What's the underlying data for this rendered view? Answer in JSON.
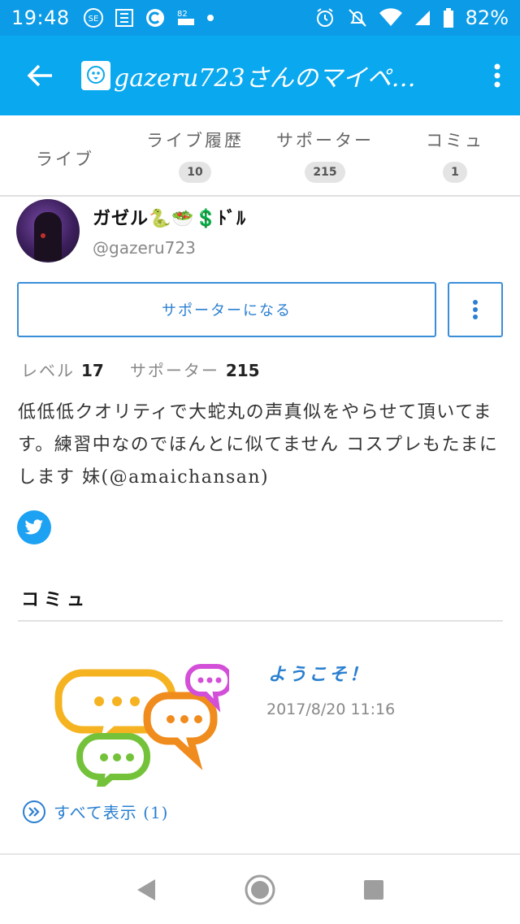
{
  "status_bar": {
    "time": "19:48",
    "icons": [
      "sim-icon",
      "moe-icon",
      "c-icon",
      "data-icon",
      "dot-icon"
    ],
    "battery_text": "82%",
    "data_speed": "82"
  },
  "app_bar": {
    "title": "gazeru723さんのマイペ…"
  },
  "tabs": [
    {
      "label": "ライブ",
      "count": ""
    },
    {
      "label": "ライブ履歴",
      "count": "10"
    },
    {
      "label": "サポーター",
      "count": "215"
    },
    {
      "label": "コミュ",
      "count": "1"
    }
  ],
  "profile": {
    "name": "ガゼル🐍🥗💲ﾄﾞﾙ",
    "handle": "@gazeru723"
  },
  "buttons": {
    "support_label": "サポーターになる"
  },
  "stats": {
    "level_label": "レベル",
    "level_value": "17",
    "supporter_label": "サポーター",
    "supporter_value": "215"
  },
  "bio": "低低低クオリティで大蛇丸の声真似をやらせて頂いてます。練習中なのでほんとに似てません コスプレもたまにします 妹(@amaichansan)",
  "community_section": {
    "title": "コミュ",
    "item": {
      "title": "ようこそ！",
      "date": "2017/8/20 11:16"
    },
    "show_all_label": "すべて表示 (1)"
  },
  "colors": {
    "status_bar": "#0c9be6",
    "app_bar": "#0aa8ee",
    "accent": "#2a7fd0",
    "twitter": "#1da1f2"
  }
}
